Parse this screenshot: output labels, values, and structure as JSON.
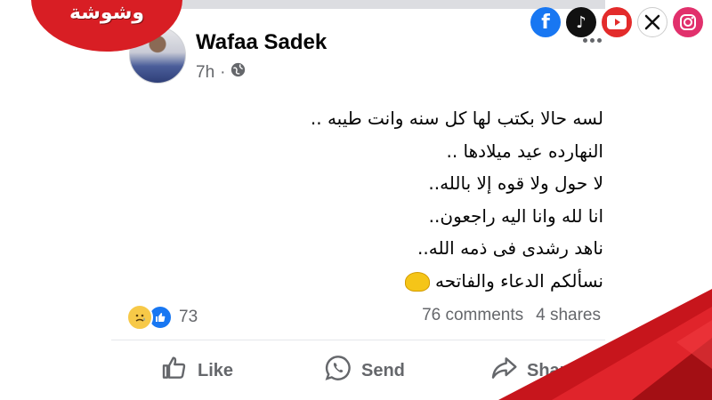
{
  "brand": {
    "text": "وشوشة",
    "color": "#d81e24"
  },
  "social_icons": [
    {
      "icon": "facebook-icon",
      "glyph": "f",
      "color": "#1877f2"
    },
    {
      "icon": "tiktok-icon",
      "glyph": "♪",
      "color": "#111111"
    },
    {
      "icon": "youtube-icon",
      "glyph": "▶",
      "color": "#e32b2b"
    },
    {
      "icon": "x-icon",
      "glyph": "𝕏",
      "color": "#111111"
    },
    {
      "icon": "instagram-icon",
      "glyph": "◎",
      "color": "#e1306c"
    }
  ],
  "post": {
    "author": "Wafaa Sadek",
    "time": "7h",
    "audience_icon": "globe-icon",
    "lines": [
      "لسه حالا بكتب لها كل سنه وانت طيبه ..",
      "النهارده عيد ميلادها ..",
      "لا حول ولا قوه إلا بالله..",
      "انا لله وانا اليه راجعون..",
      "ناهد رشدى فى ذمه الله..",
      "نسألكم الدعاء والفاتحه"
    ],
    "reactions": {
      "icons": [
        "sad-reaction-icon",
        "like-reaction-icon"
      ],
      "count": "73"
    },
    "comments": "76 comments",
    "shares": "4 shares"
  },
  "actions": {
    "like": "Like",
    "send": "Send",
    "share": "Share"
  }
}
